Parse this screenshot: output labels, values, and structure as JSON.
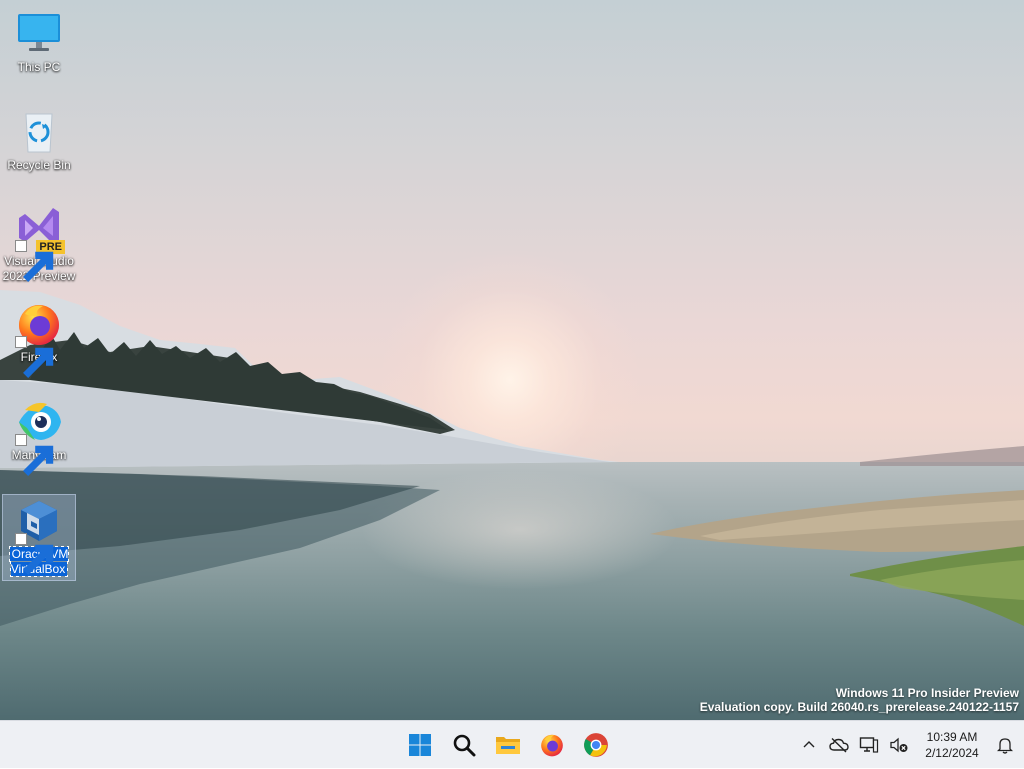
{
  "desktop": {
    "icons": [
      {
        "label": "This PC"
      },
      {
        "label": "Recycle Bin"
      },
      {
        "label": "Visual Studio 2022 Preview",
        "badge": "PRE"
      },
      {
        "label": "Firefox"
      },
      {
        "label": "ManyCam"
      },
      {
        "label": "Oracle VM VirtualBox"
      }
    ],
    "watermark": {
      "line1": "Windows 11 Pro Insider Preview",
      "line2": "Evaluation copy. Build 26040.rs_prerelease.240122-1157"
    }
  },
  "taskbar": {
    "apps": [
      {
        "icon": "windows-start-icon"
      },
      {
        "icon": "search-icon"
      },
      {
        "icon": "file-explorer-icon"
      },
      {
        "icon": "firefox-icon"
      },
      {
        "icon": "chrome-icon"
      }
    ],
    "tray": {
      "icons": [
        "chevron-up-icon",
        "cloud-offline-icon",
        "network-icon",
        "speaker-muted-icon"
      ],
      "clock": {
        "time": "10:39 AM",
        "date": "2/12/2024"
      },
      "notification_icon": "bell-icon"
    }
  },
  "colors": {
    "accent": "#0a64d8",
    "taskbar_bg": "#eef0f4",
    "windows_blue": "#1a86d9"
  }
}
